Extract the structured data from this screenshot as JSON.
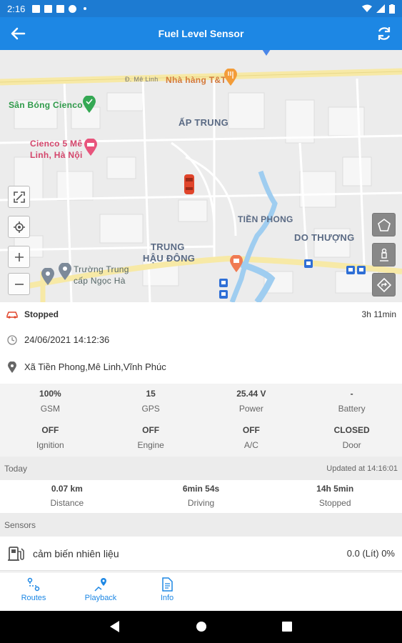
{
  "statusbar": {
    "time": "2:16"
  },
  "appbar": {
    "title": "Fuel Level Sensor"
  },
  "map": {
    "labels": {
      "street": "Đ. Mê Linh",
      "restaurant": "Nhà hàng T&T",
      "stadium": "Sân Bóng Cienco",
      "hotel_line1": "Cienco 5 Mê",
      "hotel_line2": "Linh, Hà Nội",
      "area1": "ẤP TRUNG",
      "area2": "TIỀN PHONG",
      "area3": "DO THƯỢNG",
      "area4_line1": "TRUNG",
      "area4_line2": "HẬU ĐÔNG",
      "school_line1": "Trường Trung",
      "school_line2": "cấp Ngọc Hà"
    }
  },
  "status": {
    "state": "Stopped",
    "duration": "3h 11min",
    "datetime": "24/06/2021 14:12:36",
    "address": "Xã Tiền Phong,Mê Linh,Vĩnh Phúc"
  },
  "metrics": [
    [
      {
        "value": "100%",
        "label": "GSM"
      },
      {
        "value": "15",
        "label": "GPS"
      },
      {
        "value": "25.44 V",
        "label": "Power"
      },
      {
        "value": "-",
        "label": "Battery"
      }
    ],
    [
      {
        "value": "OFF",
        "label": "Ignition"
      },
      {
        "value": "OFF",
        "label": "Engine"
      },
      {
        "value": "OFF",
        "label": "A/C"
      },
      {
        "value": "CLOSED",
        "label": "Door"
      }
    ]
  ],
  "today": {
    "header": "Today",
    "updated": "Updated at  14:16:01",
    "items": [
      {
        "value": "0.07 km",
        "label": "Distance"
      },
      {
        "value": "6min 54s",
        "label": "Driving"
      },
      {
        "value": "14h 5min",
        "label": "Stopped"
      }
    ]
  },
  "sensors": {
    "header": "Sensors",
    "items": [
      {
        "name": "cảm biến nhiên liệu",
        "value": "0.0 (Lít) 0%"
      }
    ]
  },
  "nav": {
    "routes": "Routes",
    "playback": "Playback",
    "info": "Info"
  },
  "colors": {
    "primary": "#1d87e4",
    "stopped": "#e0452b"
  }
}
